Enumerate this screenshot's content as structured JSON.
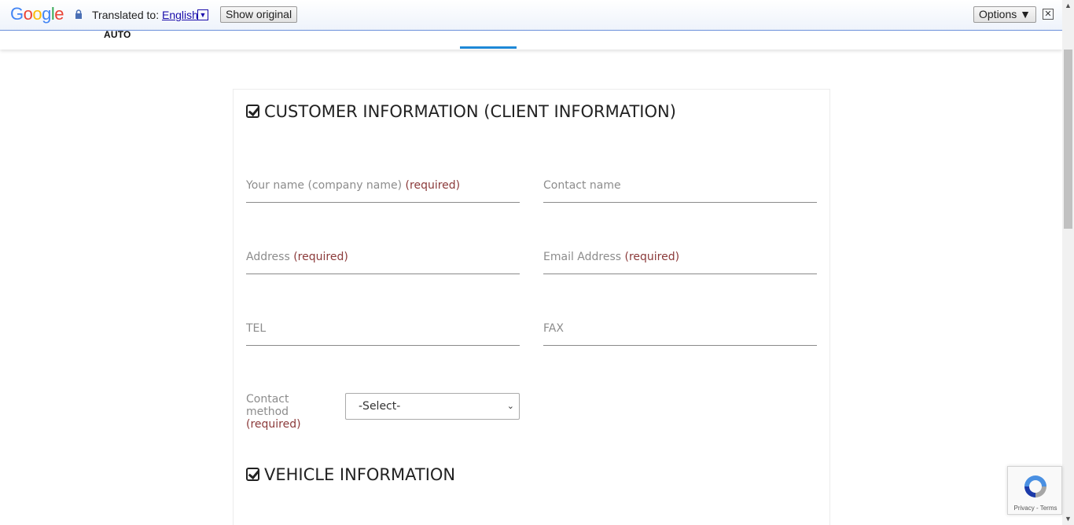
{
  "translate_bar": {
    "logo": "Google",
    "translated_to": "Translated to:",
    "language": "English",
    "show_original": "Show original",
    "options": "Options ▼",
    "close": "✕"
  },
  "site": {
    "logo_text": "AUTO"
  },
  "form": {
    "customer_section_title": "CUSTOMER INFORMATION (CLIENT INFORMATION)",
    "vehicle_section_title": "VEHICLE INFORMATION",
    "fields": {
      "name_label": "Your name (company name)",
      "name_req": "(required)",
      "contact_name_label": "Contact name",
      "address_label": "Address",
      "address_req": "(required)",
      "email_label": "Email Address",
      "email_req": "(required)",
      "tel_label": "TEL",
      "fax_label": "FAX"
    },
    "contact_method": {
      "label": "Contact method",
      "req": "(required)",
      "selected": "-Select-"
    }
  },
  "recaptcha": {
    "links": "Privacy - Terms"
  },
  "colors": {
    "accent": "#1e88d6",
    "required": "#8b3a3a"
  }
}
